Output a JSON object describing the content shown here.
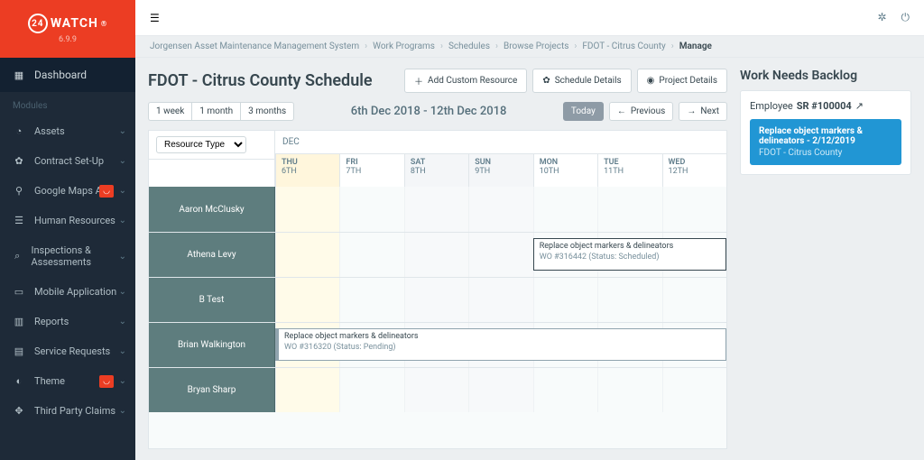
{
  "brand": {
    "name": "WATCH",
    "coin": "24",
    "version": "6.9.9"
  },
  "sidebar": {
    "dashboard": "Dashboard",
    "modules_label": "Modules",
    "items": [
      {
        "label": "Assets",
        "icon_name": "gauge-icon",
        "glyph": "◔",
        "eye": false
      },
      {
        "label": "Contract Set-Up",
        "icon_name": "gear-icon",
        "glyph": "✿",
        "eye": false
      },
      {
        "label": "Google Maps API",
        "icon_name": "pin-icon",
        "glyph": "⚲",
        "eye": true
      },
      {
        "label": "Human Resources",
        "icon_name": "users-icon",
        "glyph": "☰",
        "eye": false
      },
      {
        "label": "Inspections & Assessments",
        "icon_name": "search-icon",
        "glyph": "⌕",
        "eye": false
      },
      {
        "label": "Mobile Application",
        "icon_name": "phone-icon",
        "glyph": "▭",
        "eye": false
      },
      {
        "label": "Reports",
        "icon_name": "chart-icon",
        "glyph": "▥",
        "eye": false
      },
      {
        "label": "Service Requests",
        "icon_name": "clipboard-icon",
        "glyph": "▤",
        "eye": false
      },
      {
        "label": "Theme",
        "icon_name": "contrast-icon",
        "glyph": "◐",
        "eye": true
      },
      {
        "label": "Third Party Claims",
        "icon_name": "handshake-icon",
        "glyph": "✥",
        "eye": false
      }
    ]
  },
  "breadcrumb": [
    "Jorgensen Asset Maintenance Management System",
    "Work Programs",
    "Schedules",
    "Browse Projects",
    "FDOT - Citrus County",
    "Manage"
  ],
  "page": {
    "title": "FDOT - Citrus County Schedule",
    "buttons": {
      "add_resource": "Add Custom Resource",
      "schedule_details": "Schedule Details",
      "project_details": "Project Details"
    }
  },
  "toolbar": {
    "ranges": [
      "1 week",
      "1 month",
      "3 months"
    ],
    "date_range": "6th Dec 2018 - 12th Dec 2018",
    "today": "Today",
    "previous": "Previous",
    "next": "Next"
  },
  "scheduler": {
    "resource_filter_label": "Resource Type",
    "month_label": "DEC",
    "days": [
      {
        "dow": "THU",
        "num": "6TH",
        "today": true,
        "wknd": false
      },
      {
        "dow": "FRI",
        "num": "7TH",
        "today": false,
        "wknd": false
      },
      {
        "dow": "SAT",
        "num": "8TH",
        "today": false,
        "wknd": true
      },
      {
        "dow": "SUN",
        "num": "9TH",
        "today": false,
        "wknd": true
      },
      {
        "dow": "MON",
        "num": "10TH",
        "today": false,
        "wknd": false
      },
      {
        "dow": "TUE",
        "num": "11TH",
        "today": false,
        "wknd": false
      },
      {
        "dow": "WED",
        "num": "12TH",
        "today": false,
        "wknd": false
      }
    ],
    "resources": [
      "Aaron McClusky",
      "Athena Levy",
      "B Test",
      "Brian Walkington",
      "Bryan Sharp"
    ],
    "events": [
      {
        "row": 1,
        "start": 4,
        "span": 3,
        "title": "Replace object markers & delineators",
        "sub": "WO #316442 (Status: Scheduled)",
        "pending": false
      },
      {
        "row": 3,
        "start": 0,
        "span": 7,
        "title": "Replace object markers & delineators",
        "sub": "WO #316320 (Status: Pending)",
        "pending": true
      }
    ]
  },
  "backlog": {
    "title": "Work Needs Backlog",
    "employee_label": "Employee",
    "sr": "SR #100004",
    "ext_icon": "↗",
    "item": {
      "line1": "Replace object markers & delineators - 2/12/2019",
      "line2": "FDOT - Citrus County"
    }
  }
}
